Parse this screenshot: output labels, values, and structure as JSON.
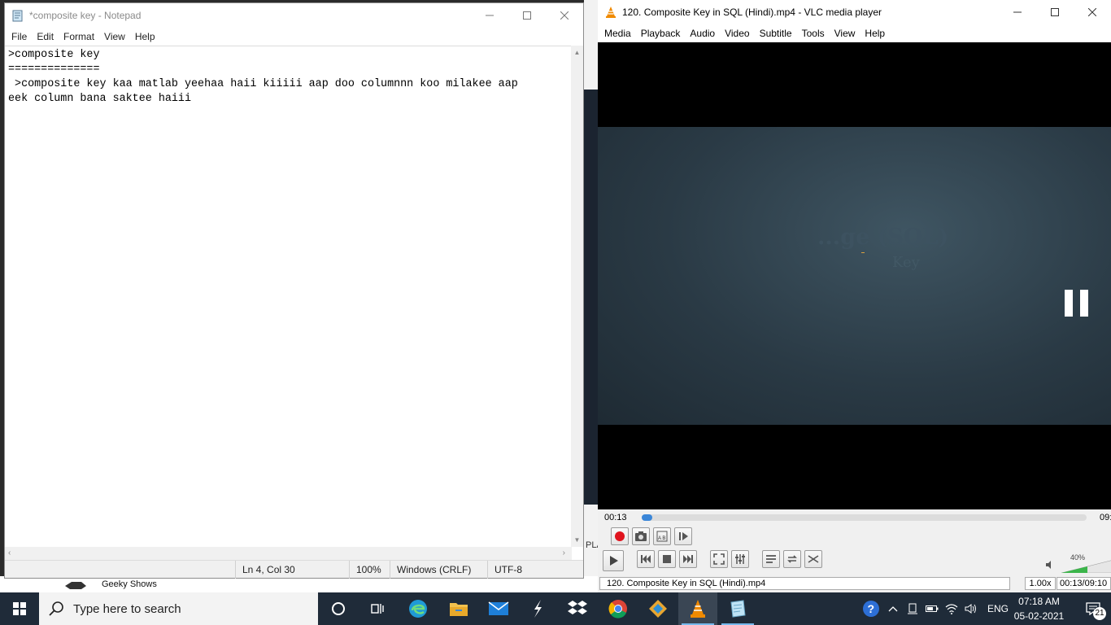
{
  "notepad": {
    "title": "*composite key - Notepad",
    "menu": [
      "File",
      "Edit",
      "Format",
      "View",
      "Help"
    ],
    "content": ">composite key\n==============\n >composite key kaa matlab yeehaa haii kiiiii aap doo columnnn koo milakee aap\neek column bana saktee haiii",
    "status": {
      "position": "Ln 4, Col 30",
      "zoom": "100%",
      "line_ending": "Windows (CRLF)",
      "encoding": "UTF-8"
    }
  },
  "background": {
    "channel_name": "Geeky Shows",
    "partial_text": "PLA"
  },
  "vlc": {
    "title": "120. Composite Key in SQL (Hindi).mp4 - VLC media player",
    "menu": [
      "Media",
      "Playback",
      "Audio",
      "Video",
      "Subtitle",
      "Tools",
      "View",
      "Help"
    ],
    "slide": {
      "title": "...ge (SQL)",
      "subtitle": "Key"
    },
    "time_current": "00:13",
    "time_end": "09:",
    "progress": 0.024,
    "volume": {
      "label": "40%",
      "level": 0.4
    },
    "status": {
      "filename": "120. Composite Key in SQL (Hindi).mp4",
      "speed": "1.00x",
      "time": "00:13/09:10"
    },
    "colors": {
      "record": "#e0141e",
      "progress": "#3a86d8",
      "volume": "#3bb54a"
    }
  },
  "taskbar": {
    "search_placeholder": "Type here to search",
    "apps": [
      "cortana-icon",
      "task-view-icon",
      "edge-icon",
      "file-explorer-icon",
      "mail-icon",
      "sublime-icon",
      "dropbox-icon",
      "chrome-icon",
      "git-icon",
      "vlc-icon",
      "notepad-icon"
    ],
    "language": "ENG",
    "time": "07:18 AM",
    "date": "05-02-2021",
    "notifications": "21"
  }
}
